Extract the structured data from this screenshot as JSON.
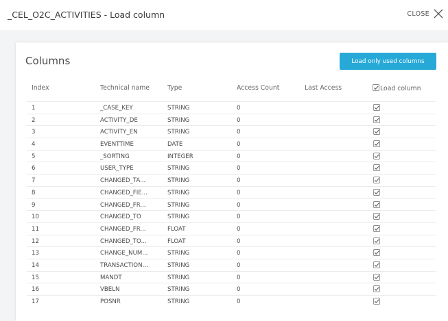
{
  "dialog": {
    "title": "_CEL_O2C_ACTIVITIES - Load column",
    "close_label": "CLOSE"
  },
  "panel": {
    "title": "Columns",
    "load_button_label": "Load only used columns"
  },
  "table": {
    "headers": {
      "index": "Index",
      "technical_name": "Technical name",
      "type": "Type",
      "access_count": "Access Count",
      "last_access": "Last Access",
      "load_column": "Load column"
    },
    "rows": [
      {
        "index": "1",
        "name": "_CASE_KEY",
        "type": "STRING",
        "access_count": "0",
        "last_access": "",
        "load": true
      },
      {
        "index": "2",
        "name": "ACTIVITY_DE",
        "type": "STRING",
        "access_count": "0",
        "last_access": "",
        "load": true
      },
      {
        "index": "3",
        "name": "ACTIVITY_EN",
        "type": "STRING",
        "access_count": "0",
        "last_access": "",
        "load": true
      },
      {
        "index": "4",
        "name": "EVENTTIME",
        "type": "DATE",
        "access_count": "0",
        "last_access": "",
        "load": true
      },
      {
        "index": "5",
        "name": "_SORTING",
        "type": "INTEGER",
        "access_count": "0",
        "last_access": "",
        "load": true
      },
      {
        "index": "6",
        "name": "USER_TYPE",
        "type": "STRING",
        "access_count": "0",
        "last_access": "",
        "load": true
      },
      {
        "index": "7",
        "name": "CHANGED_TA...",
        "type": "STRING",
        "access_count": "0",
        "last_access": "",
        "load": true
      },
      {
        "index": "8",
        "name": "CHANGED_FIE...",
        "type": "STRING",
        "access_count": "0",
        "last_access": "",
        "load": true
      },
      {
        "index": "9",
        "name": "CHANGED_FR...",
        "type": "STRING",
        "access_count": "0",
        "last_access": "",
        "load": true
      },
      {
        "index": "10",
        "name": "CHANGED_TO",
        "type": "STRING",
        "access_count": "0",
        "last_access": "",
        "load": true
      },
      {
        "index": "11",
        "name": "CHANGED_FR...",
        "type": "FLOAT",
        "access_count": "0",
        "last_access": "",
        "load": true
      },
      {
        "index": "12",
        "name": "CHANGED_TO...",
        "type": "FLOAT",
        "access_count": "0",
        "last_access": "",
        "load": true
      },
      {
        "index": "13",
        "name": "CHANGE_NUM...",
        "type": "STRING",
        "access_count": "0",
        "last_access": "",
        "load": true
      },
      {
        "index": "14",
        "name": "TRANSACTION...",
        "type": "STRING",
        "access_count": "0",
        "last_access": "",
        "load": true
      },
      {
        "index": "15",
        "name": "MANDT",
        "type": "STRING",
        "access_count": "0",
        "last_access": "",
        "load": true
      },
      {
        "index": "16",
        "name": "VBELN",
        "type": "STRING",
        "access_count": "0",
        "last_access": "",
        "load": true
      },
      {
        "index": "17",
        "name": "POSNR",
        "type": "STRING",
        "access_count": "0",
        "last_access": "",
        "load": true
      }
    ]
  },
  "colors": {
    "accent": "#27a9d8",
    "backdrop": "#f3f4f5"
  },
  "icons": {
    "close": "close-x-icon",
    "checkbox": "checkbox-checked-icon"
  }
}
